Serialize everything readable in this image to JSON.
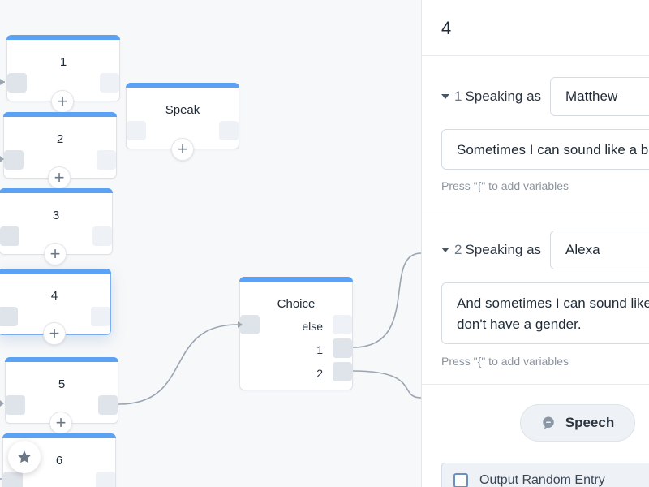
{
  "canvas": {
    "nodes": [
      {
        "id": "node-1",
        "title": "1"
      },
      {
        "id": "node-2",
        "title": "2"
      },
      {
        "id": "node-3",
        "title": "3"
      },
      {
        "id": "node-4",
        "title": "4"
      },
      {
        "id": "node-5",
        "title": "5"
      },
      {
        "id": "node-6",
        "title": "6"
      }
    ],
    "speak_node": {
      "title": "Speak"
    },
    "choice_node": {
      "title": "Choice",
      "options": [
        "else",
        "1",
        "2"
      ]
    },
    "add_symbol": "+",
    "accent_color": "#5ba2f4",
    "wire_color": "#9aa5b1",
    "fab_icon": "star-icon"
  },
  "panel": {
    "title": "4",
    "entries": [
      {
        "index": "1",
        "speaking_label": "Speaking as",
        "voice": "Matthew",
        "text": "Sometimes I can sound like a bo",
        "hint": "Press \"{\" to add variables"
      },
      {
        "index": "2",
        "speaking_label": "Speaking as",
        "voice": "Alexa",
        "text_line1": "And sometimes I can sound like",
        "text_line2": "don't have a gender.",
        "hint": "Press \"{\" to add variables"
      }
    ],
    "speech_button": "Speech",
    "speech_icon": "speech-bubble-icon",
    "random_label": "Output Random Entry"
  }
}
